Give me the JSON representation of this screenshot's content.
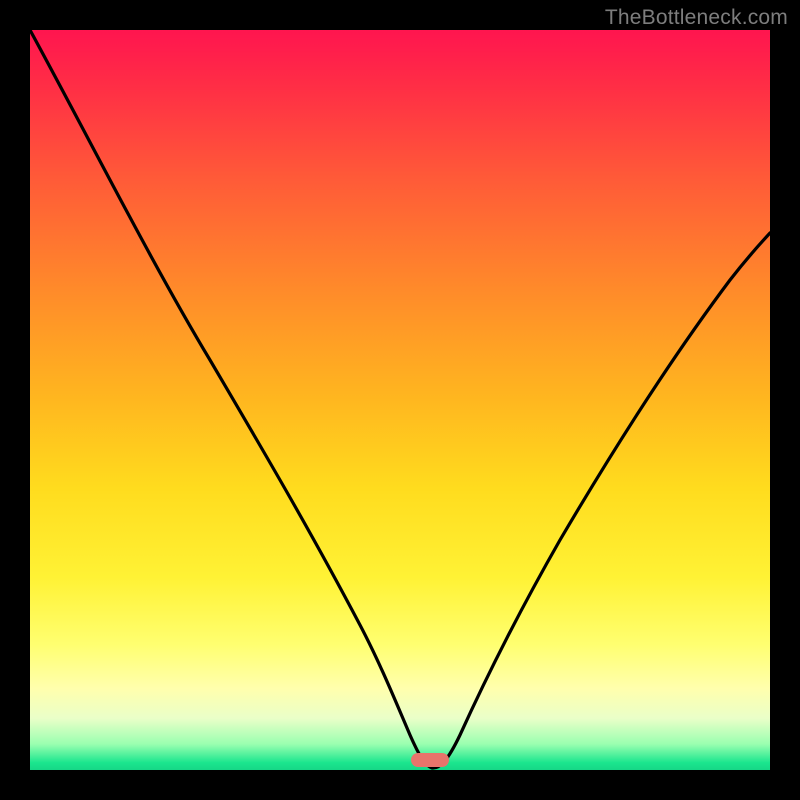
{
  "attribution": "TheBottleneck.com",
  "colors": {
    "page_bg": "#000000",
    "curve_stroke": "#000000",
    "marker_fill": "#e8746b",
    "gradient_stops": [
      "#ff154f",
      "#ff2f45",
      "#ff5a38",
      "#ff8a2a",
      "#ffb71f",
      "#ffdc1e",
      "#fff235",
      "#ffff70",
      "#ffffad",
      "#eaffc8",
      "#9affb0",
      "#1be68e",
      "#16d787"
    ]
  },
  "chart_data": {
    "type": "line",
    "title": "",
    "xlabel": "",
    "ylabel": "",
    "xlim": [
      0,
      100
    ],
    "ylim": [
      0,
      100
    ],
    "grid": false,
    "legend": false,
    "series": [
      {
        "name": "curve",
        "x": [
          0,
          6,
          12,
          18,
          24,
          30,
          36,
          42,
          47,
          50,
          52,
          54,
          56,
          60,
          66,
          72,
          78,
          85,
          92,
          100
        ],
        "y": [
          100,
          89,
          78,
          68,
          58,
          49,
          41,
          32,
          21,
          11,
          3,
          0,
          2,
          8,
          18,
          28,
          38,
          49,
          59,
          71
        ]
      }
    ],
    "marker": {
      "x": 54,
      "y": 0,
      "shape": "rounded-rect"
    }
  }
}
